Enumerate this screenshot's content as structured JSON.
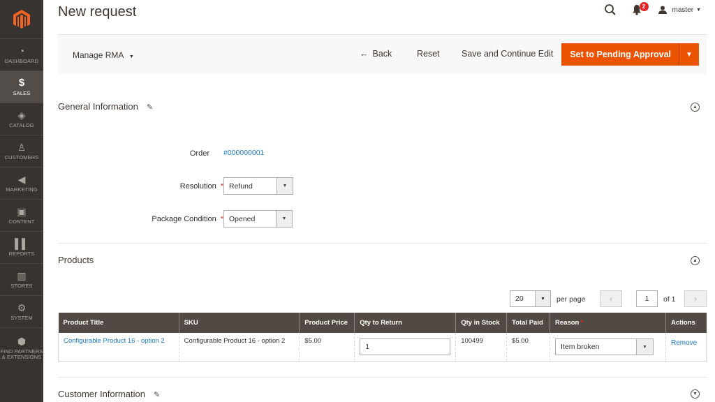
{
  "header": {
    "page_title": "New request",
    "notifications_count": "2",
    "user_name": "master"
  },
  "sidebar": {
    "items": [
      {
        "label": "Dashboard",
        "icon": "speedometer-icon"
      },
      {
        "label": "Sales",
        "icon": "dollar-icon"
      },
      {
        "label": "Catalog",
        "icon": "box-icon"
      },
      {
        "label": "Customers",
        "icon": "person-icon"
      },
      {
        "label": "Marketing",
        "icon": "megaphone-icon"
      },
      {
        "label": "Content",
        "icon": "layout-icon"
      },
      {
        "label": "Reports",
        "icon": "bar-chart-icon"
      },
      {
        "label": "Stores",
        "icon": "storefront-icon"
      },
      {
        "label": "System",
        "icon": "gear-icon"
      },
      {
        "label": "Find Partners & Extensions",
        "icon": "cube-icon"
      }
    ]
  },
  "toolbar": {
    "manage_label": "Manage RMA",
    "back_label": "Back",
    "reset_label": "Reset",
    "save_continue_label": "Save and Continue Edit",
    "primary_label": "Set to Pending Approval"
  },
  "general": {
    "title": "General Information",
    "order_label": "Order",
    "order_value": "#000000001",
    "resolution_label": "Resolution",
    "resolution_value": "Refund",
    "condition_label": "Package Condition",
    "condition_value": "Opened"
  },
  "products": {
    "title": "Products",
    "per_page_value": "20",
    "per_page_label": "per page",
    "page_value": "1",
    "page_of": "of 1",
    "columns": [
      "Product Title",
      "SKU",
      "Product Price",
      "Qty to Return",
      "Qty in Stock",
      "Total Paid",
      "Reason",
      "Actions"
    ],
    "row": {
      "title": "Configurable Product 16 - option 2",
      "sku": "Configurable Product 16 - option 2",
      "price": "$5.00",
      "qty_return": "1",
      "qty_stock": "100499",
      "total_paid": "$5.00",
      "reason": "Item broken",
      "action": "Remove"
    }
  },
  "customer": {
    "title": "Customer Information"
  },
  "colors": {
    "accent": "#eb5202",
    "sidebar": "#373330",
    "table_header": "#514943",
    "link": "#1979c3"
  }
}
